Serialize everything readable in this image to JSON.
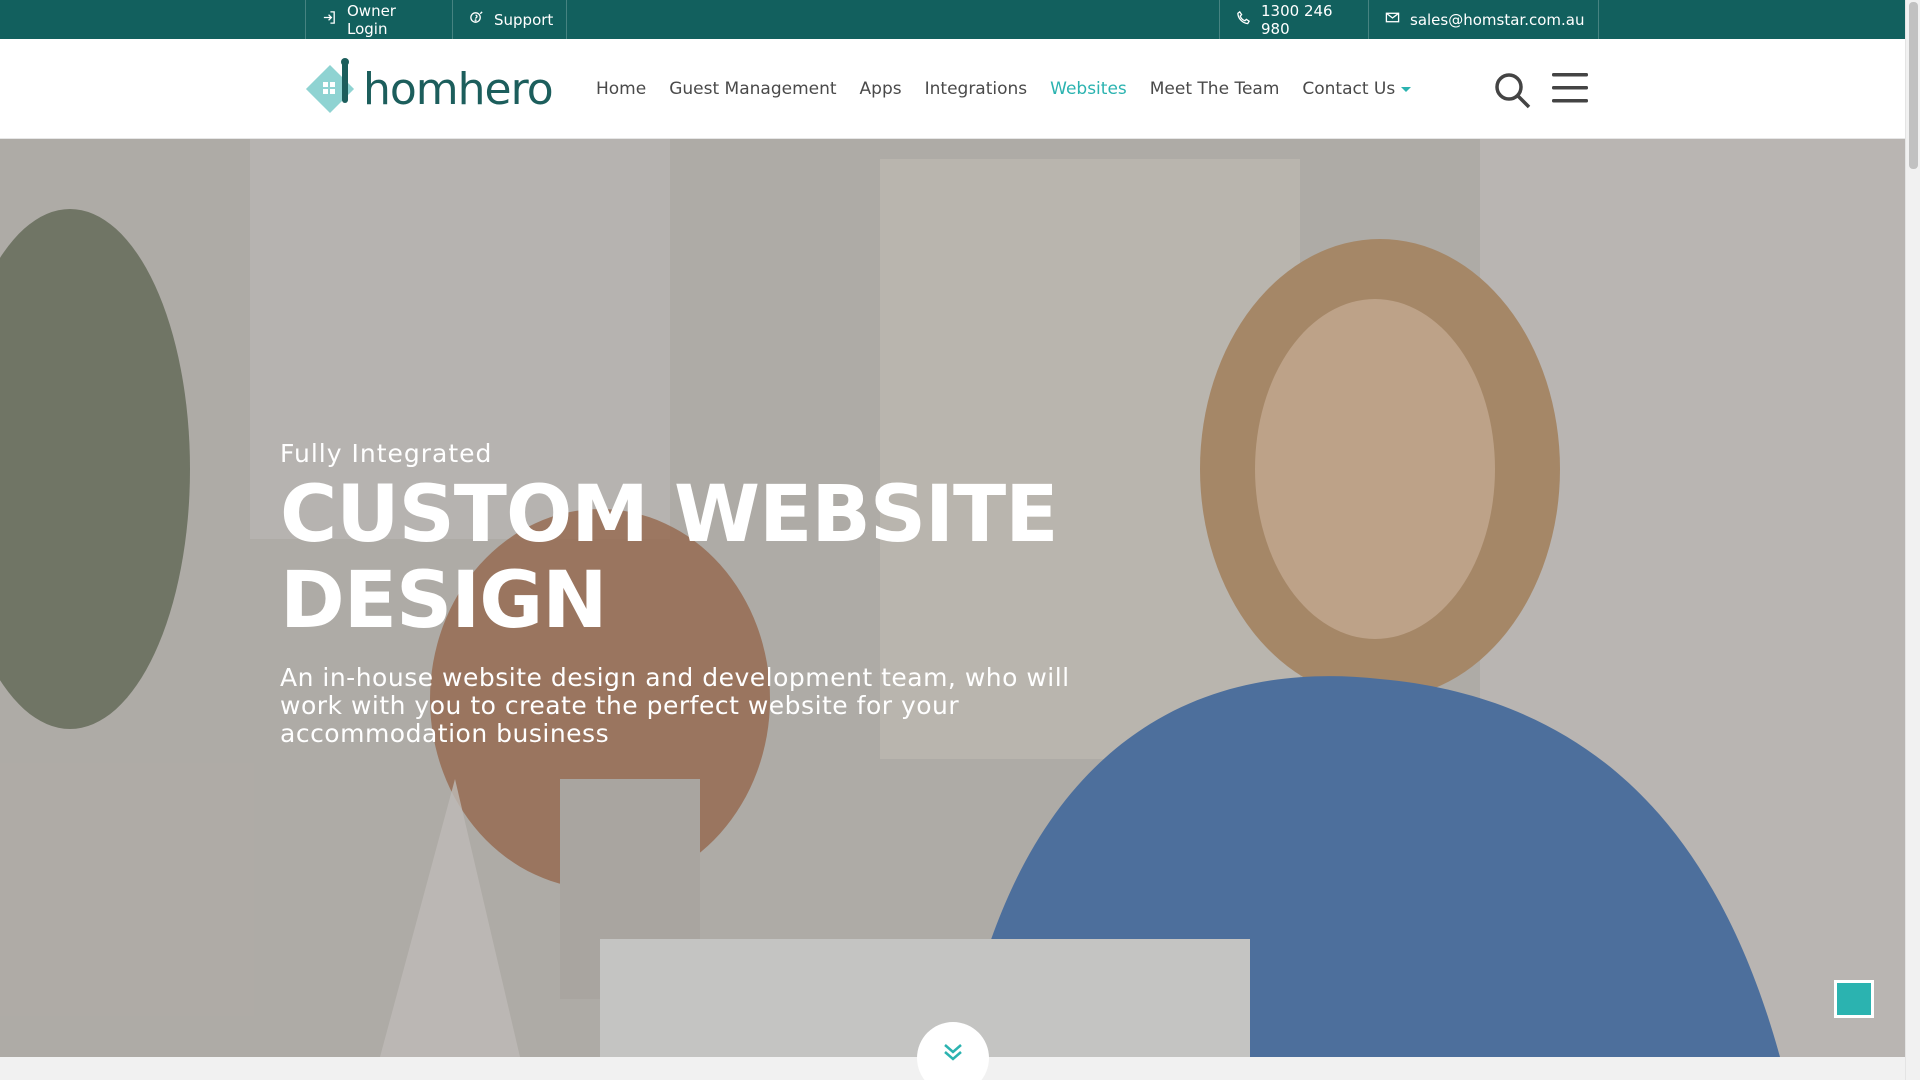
{
  "topbar": {
    "owner_login": "Owner Login",
    "support": "Support",
    "phone": "1300 246 980",
    "email": "sales@homstar.com.au"
  },
  "logo": {
    "text": "homhero"
  },
  "nav": {
    "items": [
      {
        "label": "Home"
      },
      {
        "label": "Guest Management"
      },
      {
        "label": "Apps"
      },
      {
        "label": "Integrations"
      },
      {
        "label": "Websites",
        "active": true
      },
      {
        "label": "Meet The Team"
      },
      {
        "label": "Contact Us",
        "has_dropdown": true
      }
    ]
  },
  "hero": {
    "eyebrow": "Fully Integrated",
    "headline": "CUSTOM WEBSITE DESIGN",
    "subtext": "An in-house website design and development team, who will work with you to create the perfect website for your accommodation business"
  },
  "icons": {
    "owner_login": "login-icon",
    "support": "support-icon",
    "phone": "phone-icon",
    "email": "envelope-icon",
    "search": "search-icon",
    "menu": "hamburger-menu-icon",
    "scroll_down": "double-chevron-down-icon",
    "to_top": "back-to-top-button"
  },
  "colors": {
    "topbar": "#12605e",
    "accent": "#2bb3b0",
    "nav_text": "#4a4a4a",
    "logo_text": "#1c5e5c"
  }
}
